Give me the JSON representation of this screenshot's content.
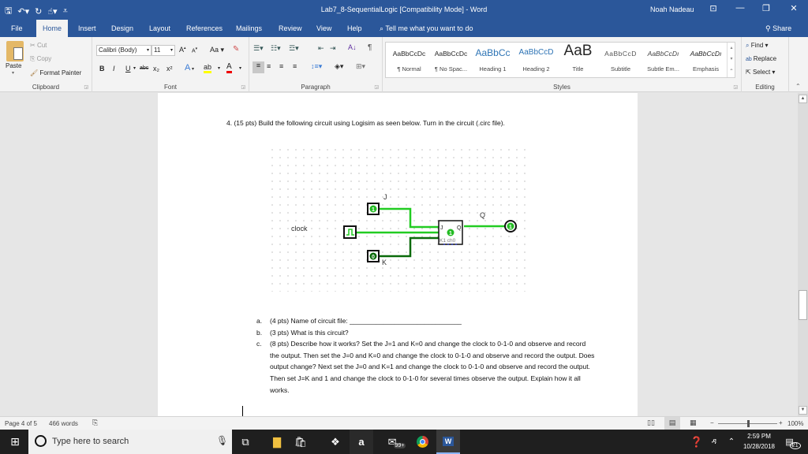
{
  "window": {
    "title": "Lab7_8-SequentialLogic [Compatibility Mode]  -  Word",
    "user": "Noah Nadeau"
  },
  "tabs": [
    {
      "label": "File"
    },
    {
      "label": "Home"
    },
    {
      "label": "Insert"
    },
    {
      "label": "Design"
    },
    {
      "label": "Layout"
    },
    {
      "label": "References"
    },
    {
      "label": "Mailings"
    },
    {
      "label": "Review"
    },
    {
      "label": "View"
    },
    {
      "label": "Help"
    }
  ],
  "tell_me": "Tell me what you want to do",
  "share": "Share",
  "ribbon": {
    "clipboard": {
      "label": "Clipboard",
      "paste": "Paste",
      "cut": "Cut",
      "copy": "Copy",
      "format_painter": "Format Painter"
    },
    "font": {
      "label": "Font",
      "font_name": "Calibri (Body)",
      "font_size": "11",
      "change_case": "Aa",
      "bold": "B",
      "italic": "I",
      "underline": "U",
      "strikethrough": "abc",
      "subscript": "x₂",
      "superscript": "x²"
    },
    "paragraph": {
      "label": "Paragraph"
    },
    "styles": {
      "label": "Styles",
      "items": [
        {
          "preview": "AaBbCcDc",
          "name": "¶ Normal"
        },
        {
          "preview": "AaBbCcDc",
          "name": "¶ No Spac..."
        },
        {
          "preview": "AaBbCc",
          "name": "Heading 1"
        },
        {
          "preview": "AaBbCcD",
          "name": "Heading 2"
        },
        {
          "preview": "AaB",
          "name": "Title"
        },
        {
          "preview": "AaBbCcD",
          "name": "Subtitle"
        },
        {
          "preview": "AaBbCcDı",
          "name": "Subtle Em..."
        },
        {
          "preview": "AaBbCcDı",
          "name": "Emphasis"
        }
      ]
    },
    "editing": {
      "label": "Editing",
      "find": "Find",
      "replace": "Replace",
      "select": "Select"
    }
  },
  "document": {
    "question": "4.   (15 pts) Build the following circuit using Logisim as seen below.  Turn in the circuit (.circ file).",
    "circuit": {
      "label_j": "J",
      "label_k": "K",
      "label_q": "Q",
      "label_clock": "clock",
      "input_j_value": "1",
      "input_k_value": "0",
      "flipflop_state": "1",
      "flipflop_label": "K1 ch0",
      "ff_pin_j": "J",
      "ff_pin_q": "Q",
      "output_q_value": "1",
      "colors": {
        "wire_on": "#22cc22",
        "wire_off": "#0a6a0a"
      }
    },
    "answers": [
      {
        "letter": "a.",
        "text": "(4 pts) Name of circuit file: ______________________________"
      },
      {
        "letter": "b.",
        "text": "(3 pts) What is this circuit?"
      },
      {
        "letter": "c.",
        "text": "(8 pts) Describe how it works?  Set the J=1 and K=0 and change the clock to 0-1-0 and observe and record the output. Then set the J=0 and K=0 and change the clock to 0-1-0 and observe and record the output. Does output change?  Next set the J=0 and K=1 and change the clock to 0-1-0 and observe and record the output.  Then set J=K and 1 and change the clock to 0-1-0 for several times observe the output.  Explain how it all works."
      }
    ]
  },
  "status": {
    "page": "Page 4 of 5",
    "words": "466 words",
    "zoom": "100%",
    "zoom_fraction": 0.5
  },
  "taskbar": {
    "search_placeholder": "Type here to search",
    "time": "2:59 PM",
    "date": "10/28/2018",
    "notifications": "21",
    "mail_badge": "99+"
  }
}
